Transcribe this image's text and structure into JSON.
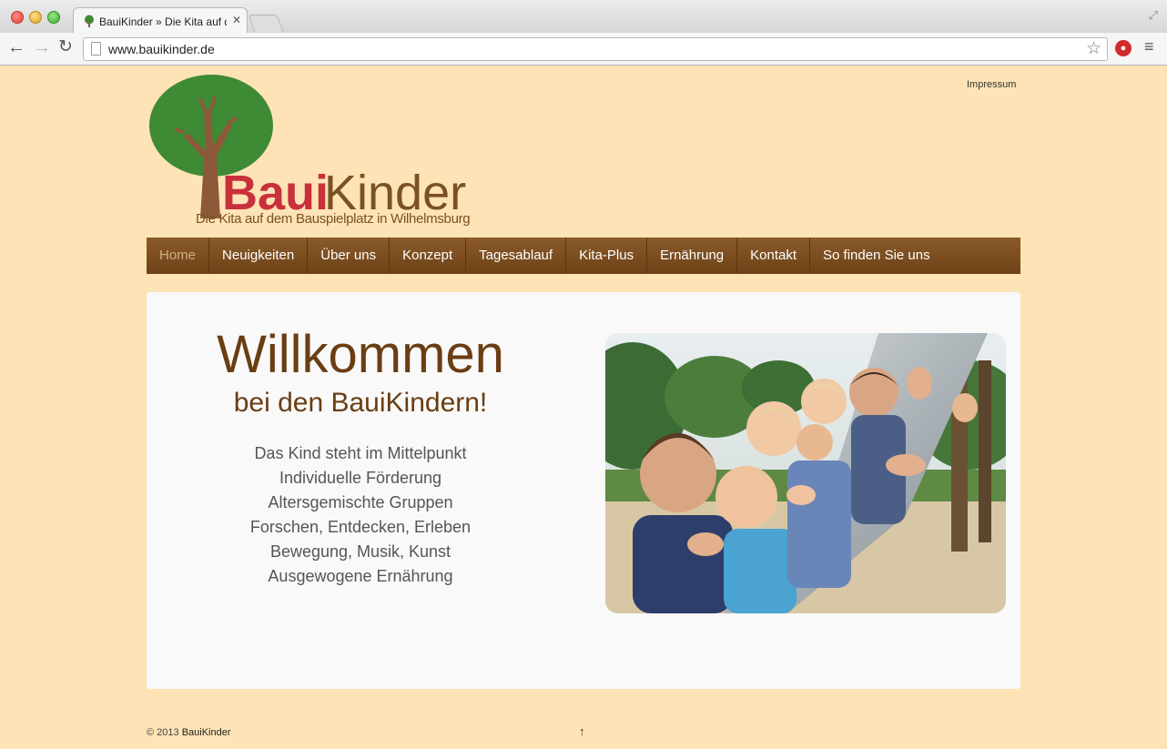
{
  "browser": {
    "tab_title": "BauiKinder » Die Kita auf dem Bauspielplatz in Wilhelmsburg",
    "tab_close": "✕",
    "url": "www.bauikinder.de",
    "back": "←",
    "forward": "→",
    "reload": "↻",
    "star": "☆",
    "menu": "≡",
    "fullscreen": "⤢"
  },
  "header": {
    "impressum": "Impressum",
    "logo_brand_part1": "Baui",
    "logo_brand_part2": "Kinder",
    "logo_tagline": "Die Kita auf dem Bauspielplatz in Wilhelmsburg"
  },
  "nav": {
    "items": [
      "Home",
      "Neuigkeiten",
      "Über uns",
      "Konzept",
      "Tagesablauf",
      "Kita-Plus",
      "Ernährung",
      "Kontakt",
      "So finden Sie uns"
    ],
    "active": "Home"
  },
  "main": {
    "title": "Willkommen",
    "subtitle": "bei den BauiKindern!",
    "features": [
      "Das Kind steht im Mittelpunkt",
      "Individuelle Förderung",
      "Altersgemischte Gruppen",
      "Forschen, Entdecken, Erleben",
      "Bewegung, Musik, Kunst",
      "Ausgewogene Ernährung"
    ]
  },
  "footer": {
    "copyright_prefix": "© 2013 ",
    "copyright_name": "BauiKinder",
    "to_top": "↑"
  },
  "colors": {
    "page_bg": "#fde3b5",
    "nav_bg": "#7a4b1e",
    "heading": "#6a3d13",
    "tree_green": "#3f8a34",
    "trunk": "#8c5a3a"
  }
}
